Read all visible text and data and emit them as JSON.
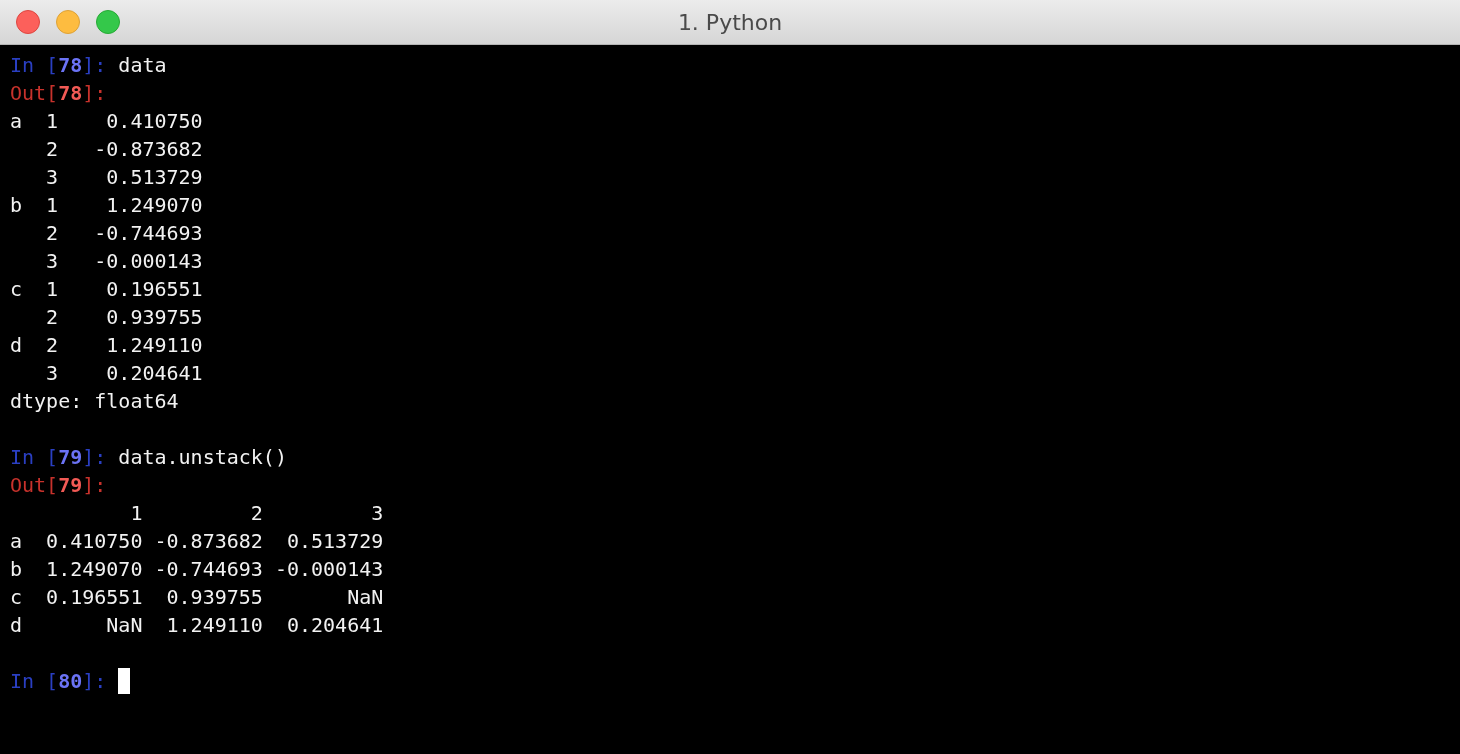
{
  "window": {
    "title": "1. Python"
  },
  "terminal": {
    "lines": [
      {
        "kind": "input",
        "prompt": [
          "In [",
          "78",
          "]:"
        ],
        "code": "data",
        "cursor": false
      },
      {
        "kind": "output",
        "prompt": [
          "Out[",
          "78",
          "]:"
        ]
      },
      {
        "kind": "text",
        "text": "a  1    0.410750"
      },
      {
        "kind": "text",
        "text": "   2   -0.873682"
      },
      {
        "kind": "text",
        "text": "   3    0.513729"
      },
      {
        "kind": "text",
        "text": "b  1    1.249070"
      },
      {
        "kind": "text",
        "text": "   2   -0.744693"
      },
      {
        "kind": "text",
        "text": "   3   -0.000143"
      },
      {
        "kind": "text",
        "text": "c  1    0.196551"
      },
      {
        "kind": "text",
        "text": "   2    0.939755"
      },
      {
        "kind": "text",
        "text": "d  2    1.249110"
      },
      {
        "kind": "text",
        "text": "   3    0.204641"
      },
      {
        "kind": "text",
        "text": "dtype: float64"
      },
      {
        "kind": "blank"
      },
      {
        "kind": "input",
        "prompt": [
          "In [",
          "79",
          "]:"
        ],
        "code": "data.unstack()",
        "cursor": false
      },
      {
        "kind": "output",
        "prompt": [
          "Out[",
          "79",
          "]:"
        ]
      },
      {
        "kind": "text",
        "text": "          1         2         3"
      },
      {
        "kind": "text",
        "text": "a  0.410750 -0.873682  0.513729"
      },
      {
        "kind": "text",
        "text": "b  1.249070 -0.744693 -0.000143"
      },
      {
        "kind": "text",
        "text": "c  0.196551  0.939755       NaN"
      },
      {
        "kind": "text",
        "text": "d       NaN  1.249110  0.204641"
      },
      {
        "kind": "blank"
      },
      {
        "kind": "input",
        "prompt": [
          "In [",
          "80",
          "]:"
        ],
        "cursor": true
      }
    ]
  }
}
